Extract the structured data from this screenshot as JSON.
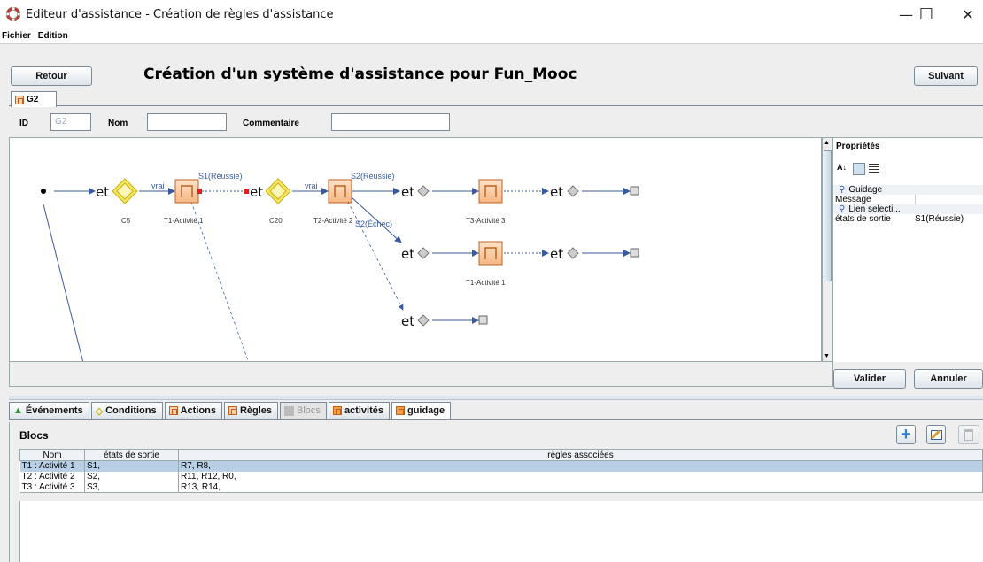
{
  "window": {
    "title": "Editeur d'assistance - Création de règles d'assistance",
    "minimize": "—",
    "maximize": "☐",
    "close": "✕"
  },
  "menu": [
    "Fichier",
    "Edition"
  ],
  "header": {
    "back_label": "Retour",
    "title": "Création d'un système d'assistance pour Fun_Mooc",
    "next_label": "Suivant"
  },
  "top_tab": {
    "label": "G2"
  },
  "id_row": {
    "id_label": "ID",
    "id_value": "G2",
    "name_label": "Nom",
    "name_value": "",
    "comment_label": "Commentaire",
    "comment_value": ""
  },
  "diagram": {
    "et": "et",
    "labels": {
      "vrai1": "vrai",
      "vrai2": "vrai",
      "c5": "C5",
      "c20": "C20",
      "t1": "T1-Activité 1",
      "t2": "T2-Activité 2",
      "t3": "T3-Activité 3",
      "t1b": "T1-Activité 1",
      "s1": "S1(Réussie)",
      "s2r": "S2(Réussie)",
      "s2e": "S2(Échec)"
    }
  },
  "properties": {
    "title": "Propriétés",
    "guidage": "Guidage",
    "message": "Message",
    "lien": "Lien selecti...",
    "etats_label": "états de sortie",
    "etats_value": "S1(Réussie)"
  },
  "footer_buttons": {
    "valider": "Valider",
    "annuler": "Annuler"
  },
  "bottom_tabs": [
    {
      "label": "Événements"
    },
    {
      "label": "Conditions"
    },
    {
      "label": "Actions"
    },
    {
      "label": "Règles"
    },
    {
      "label": "Blocs"
    },
    {
      "label": "activités"
    },
    {
      "label": "guidage"
    }
  ],
  "blocs": {
    "title": "Blocs",
    "columns": [
      "Nom",
      "états de sortie",
      "règles associées"
    ],
    "rows": [
      [
        "T1 : Activité 1",
        "S1,",
        "R7, R8,"
      ],
      [
        "T2 : Activité 2",
        "S2,",
        "R11, R12, R0,"
      ],
      [
        "T3 : Activité 3",
        "S3,",
        "R13, R14,"
      ]
    ]
  },
  "colors": {
    "selection": "#b8cfe5",
    "activity_fill": "#fbd0a8",
    "activity_border": "#c06020",
    "condition_fill": "#f5e46a",
    "link_blue": "#3a5aa0"
  }
}
